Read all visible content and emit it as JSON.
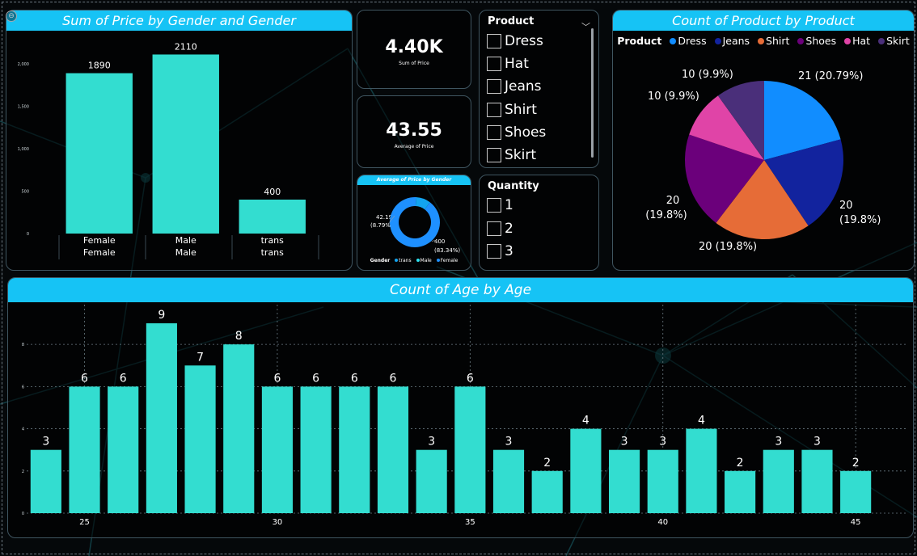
{
  "colors": {
    "accent": "#16c3f5",
    "bar": "#33ddd0",
    "text": "#ffffff"
  },
  "gender_chart": {
    "title": "Sum of Price by Gender and Gender",
    "chart_data": {
      "type": "bar",
      "categories": [
        [
          "Female",
          "Female"
        ],
        [
          "Male",
          "Male"
        ],
        [
          "trans",
          "trans"
        ]
      ],
      "values": [
        1890,
        2110,
        400
      ],
      "data_labels": [
        "1890",
        "2110",
        "400"
      ],
      "ylim": [
        0,
        2200
      ],
      "yticks": [
        0,
        500,
        1000,
        1500,
        2000
      ],
      "ytick_labels": [
        "0",
        "500",
        "1,000",
        "1,500",
        "2,000"
      ],
      "grid": false
    }
  },
  "cards": {
    "sum_price": {
      "value": "4.40K",
      "label": "Sum of Price"
    },
    "avg_price": {
      "value": "43.55",
      "label": "Average of Price"
    }
  },
  "donut": {
    "title": "Average of Price by Gender",
    "chart_data": {
      "type": "pie",
      "labels": [
        "trans",
        "Male",
        "Female"
      ],
      "values": [
        42.19,
        0.23,
        400
      ],
      "colors": [
        "#12a4f0",
        "#2de0f0",
        "#1e90ff"
      ],
      "data_labels": {
        "top": "42.19",
        "top_pct": "(8.79%)",
        "bottom": "400",
        "bottom_pct": "(83.34%)"
      },
      "legend_title": "Gender",
      "legend": [
        "trans",
        "Male",
        "Female"
      ]
    }
  },
  "product_slicer": {
    "title": "Product",
    "items": [
      "Dress",
      "Hat",
      "Jeans",
      "Shirt",
      "Shoes",
      "Skirt"
    ]
  },
  "quantity_slicer": {
    "title": "Quantity",
    "items": [
      "1",
      "2",
      "3"
    ]
  },
  "product_chart": {
    "title": "Count of Product by Product",
    "legend_title": "Product",
    "chart_data": {
      "type": "pie",
      "labels": [
        "Dress",
        "Jeans",
        "Shirt",
        "Shoes",
        "Hat",
        "Skirt"
      ],
      "values": [
        21,
        20,
        20,
        20,
        10,
        10
      ],
      "colors": [
        "#118dff",
        "#12239e",
        "#e66c37",
        "#6b007b",
        "#e044a7",
        "#4a2f7a"
      ],
      "data_labels": [
        "21 (20.79%)",
        "20 (19.8%)",
        "20 (19.8%)",
        "20 (19.8%)",
        "10 (9.9%)",
        "10 (9.9%)"
      ]
    }
  },
  "age_chart": {
    "title": "Count of Age by Age",
    "chart_data": {
      "type": "bar",
      "x": [
        24,
        25,
        26,
        27,
        28,
        29,
        30,
        31,
        32,
        33,
        34,
        35,
        36,
        37,
        38,
        39,
        40,
        41,
        42,
        43,
        44,
        45
      ],
      "values": [
        3,
        6,
        6,
        9,
        7,
        8,
        6,
        6,
        6,
        6,
        3,
        6,
        3,
        2,
        4,
        3,
        3,
        4,
        2,
        3,
        3,
        2
      ],
      "xticks": [
        25,
        30,
        35,
        40,
        45
      ],
      "xtick_labels": [
        "25",
        "30",
        "35",
        "40",
        "45"
      ],
      "yticks": [
        0,
        2,
        4,
        6,
        8
      ],
      "ytick_labels": [
        "0",
        "2",
        "4",
        "6",
        "8"
      ],
      "ylim": [
        0,
        9.5
      ],
      "grid": true
    }
  }
}
